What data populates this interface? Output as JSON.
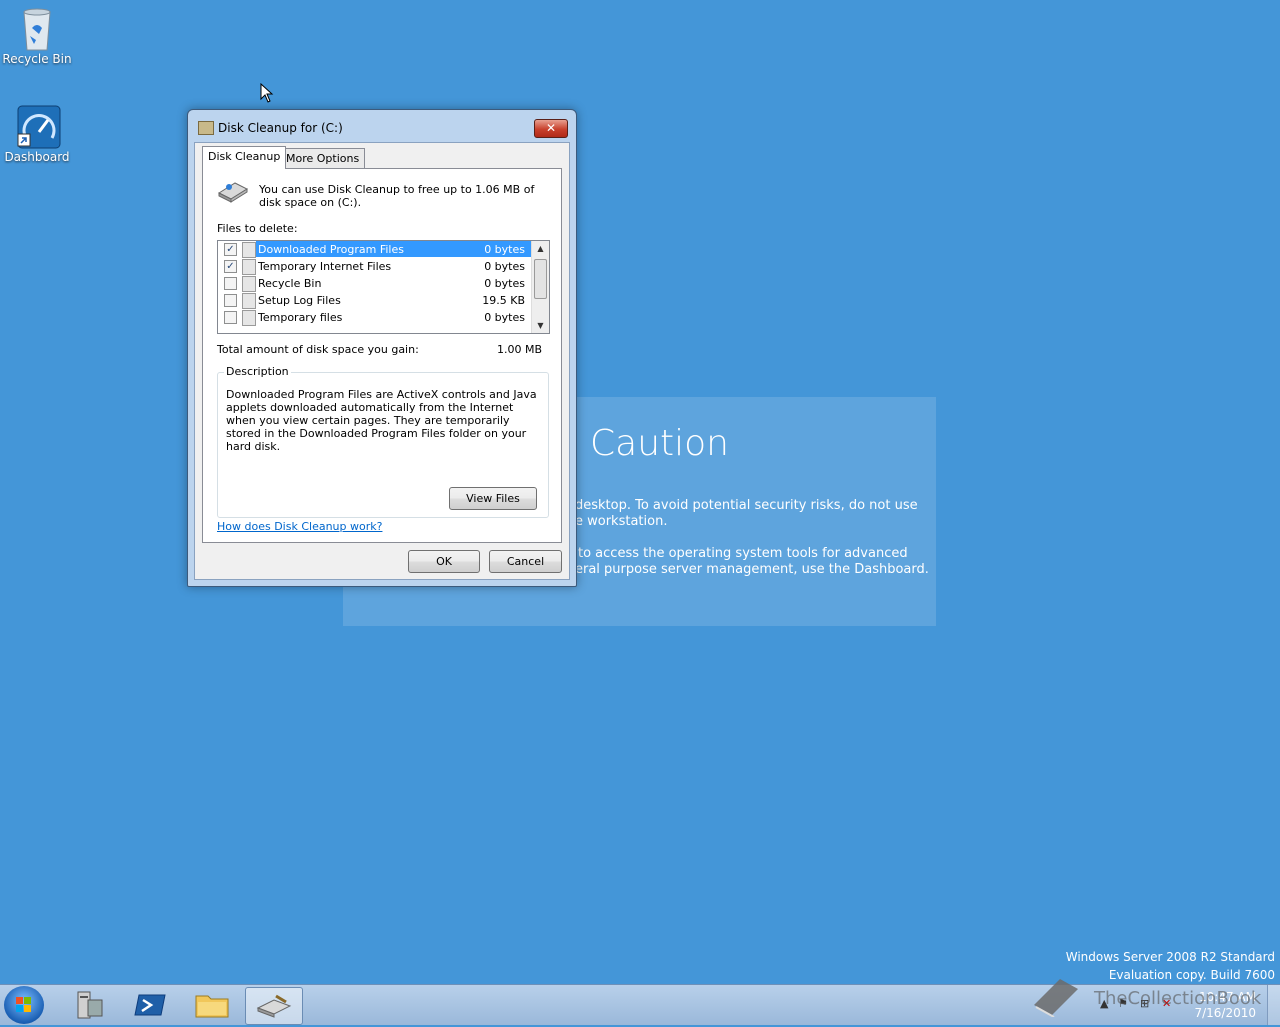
{
  "desktop": {
    "icons": [
      {
        "label": "Recycle Bin",
        "icon": "recycle-bin-icon"
      },
      {
        "label": "Dashboard",
        "icon": "dashboard-icon"
      }
    ],
    "caution": {
      "title": "Caution",
      "line1": "desktop. To avoid potential security risks, do not use",
      "line2": "e workstation.",
      "line3": "to access the operating system tools for advanced",
      "line4": "eral purpose server management, use the Dashboard."
    },
    "watermark": {
      "line1": "Windows Server 2008 R2 Standard",
      "line2": "Evaluation copy. Build 7600"
    },
    "overlay_text": "TheCollectionBook"
  },
  "dialog": {
    "title": "Disk Cleanup for  (C:)",
    "close_label": "✕",
    "tabs": [
      {
        "label": "Disk Cleanup",
        "active": true
      },
      {
        "label": "More Options",
        "active": false
      }
    ],
    "intro": "You can use Disk Cleanup to free up to 1.06 MB of disk space on  (C:).",
    "files_label": "Files to delete:",
    "files": [
      {
        "name": "Downloaded Program Files",
        "size": "0 bytes",
        "checked": true,
        "selected": true
      },
      {
        "name": "Temporary Internet Files",
        "size": "0 bytes",
        "checked": true,
        "selected": false
      },
      {
        "name": "Recycle Bin",
        "size": "0 bytes",
        "checked": false,
        "selected": false
      },
      {
        "name": "Setup Log Files",
        "size": "19.5 KB",
        "checked": false,
        "selected": false
      },
      {
        "name": "Temporary files",
        "size": "0 bytes",
        "checked": false,
        "selected": false
      }
    ],
    "total_label": "Total amount of disk space you gain:",
    "total_value": "1.00 MB",
    "description_title": "Description",
    "description": "Downloaded Program Files are ActiveX controls and Java applets downloaded automatically from the Internet when you view certain pages. They are temporarily stored in the Downloaded Program Files folder on your hard disk.",
    "view_files": "View Files",
    "help_link": "How does Disk Cleanup work?",
    "ok": "OK",
    "cancel": "Cancel"
  },
  "taskbar": {
    "buttons": [
      {
        "name": "server-manager-icon"
      },
      {
        "name": "powershell-icon"
      },
      {
        "name": "explorer-folder-icon"
      },
      {
        "name": "disk-cleanup-icon",
        "active": true
      }
    ],
    "time": "10:47 AM",
    "date": "7/16/2010"
  }
}
